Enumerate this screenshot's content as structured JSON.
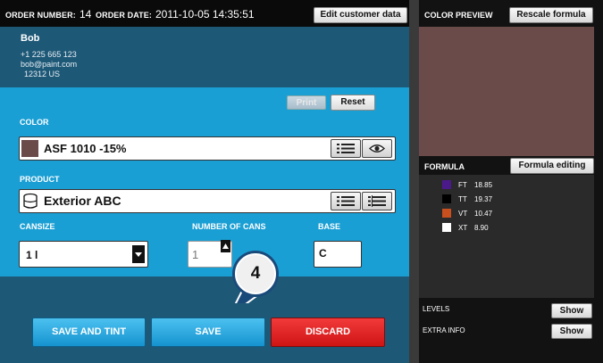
{
  "order": {
    "number_label": "ORDER NUMBER:",
    "number_value": "14",
    "date_label": "ORDER DATE:",
    "date_value": "2011-10-05 14:35:51",
    "edit_customer_label": "Edit customer data"
  },
  "customer": {
    "name": "Bob",
    "phone": "+1 225 665 123",
    "email": "bob@paint.com",
    "address": "12312 US"
  },
  "form": {
    "print_label": "Print",
    "reset_label": "Reset",
    "color_label": "COLOR",
    "color_value": "ASF 1010 -15%",
    "color_swatch": "#6b4a4a",
    "product_label": "PRODUCT",
    "product_value": "Exterior ABC",
    "cansize_label": "CANSIZE",
    "cansize_value": "1 l",
    "num_cans_label": "NUMBER OF CANS",
    "num_cans_value": "1",
    "base_label": "BASE",
    "base_value": "C"
  },
  "actions": {
    "save_tint_label": "SAVE AND TINT",
    "save_label": "SAVE",
    "discard_label": "DISCARD"
  },
  "callout": {
    "step": "4"
  },
  "right": {
    "color_preview_label": "COLOR PREVIEW",
    "rescale_label": "Rescale formula",
    "formula_label": "FORMULA",
    "formula_editing_label": "Formula editing",
    "levels_label": "LEVELS",
    "levels_show": "Show",
    "extra_info_label": "EXTRA INFO",
    "extra_info_show": "Show",
    "formula": [
      {
        "code": "FT",
        "value": "18.85",
        "color": "#4b1a8a"
      },
      {
        "code": "TT",
        "value": "19.37",
        "color": "#000000"
      },
      {
        "code": "VT",
        "value": "10.47",
        "color": "#c8501e"
      },
      {
        "code": "XT",
        "value": "8.90",
        "color": "#ffffff"
      }
    ]
  }
}
